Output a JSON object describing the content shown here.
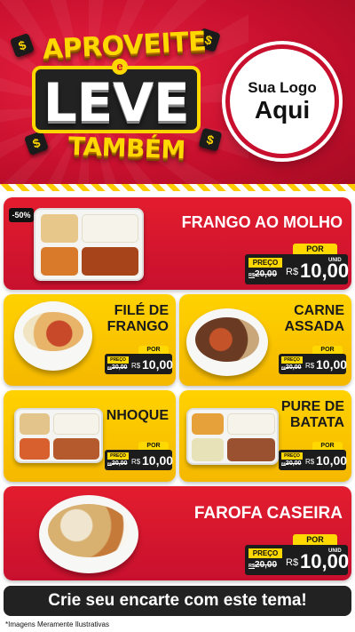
{
  "header": {
    "hero_top": "APROVEITE",
    "hero_connector": "e",
    "hero_middle": "LEVE",
    "hero_bottom": "TAMBÉM",
    "coin_symbol": "$",
    "logo_line1": "Sua Logo",
    "logo_line2": "Aqui"
  },
  "colors": {
    "brand_red": "#c8102e",
    "brand_yellow": "#ffd200",
    "tag_black": "#1c1c1c"
  },
  "discount_badge": "-50%",
  "price_labels": {
    "por": "POR",
    "preco": "PREÇO",
    "currency": "R$",
    "unit": "UNID"
  },
  "products": [
    {
      "name_line1": "FRANGO AO MOLHO",
      "name_line2": "",
      "old_currency": "R$",
      "old_price": "20,00",
      "price": "10,00"
    },
    {
      "name_line1": "FILÉ DE",
      "name_line2": "FRANGO",
      "old_currency": "R$",
      "old_price": "20,00",
      "price": "10,00"
    },
    {
      "name_line1": "CARNE",
      "name_line2": "ASSADA",
      "old_currency": "R$",
      "old_price": "20,00",
      "price": "10,00"
    },
    {
      "name_line1": "NHOQUE",
      "name_line2": "",
      "old_currency": "R$",
      "old_price": "20,00",
      "price": "10,00"
    },
    {
      "name_line1": "PURE DE",
      "name_line2": "BATATA",
      "old_currency": "R$",
      "old_price": "20,00",
      "price": "10,00"
    },
    {
      "name_line1": "FAROFA CASEIRA",
      "name_line2": "",
      "old_currency": "R$",
      "old_price": "20,00",
      "price": "10,00"
    }
  ],
  "footer": {
    "cta": "Crie seu encarte com este tema!",
    "disclaimer": "*Imagens Meramente Ilustrativas"
  }
}
